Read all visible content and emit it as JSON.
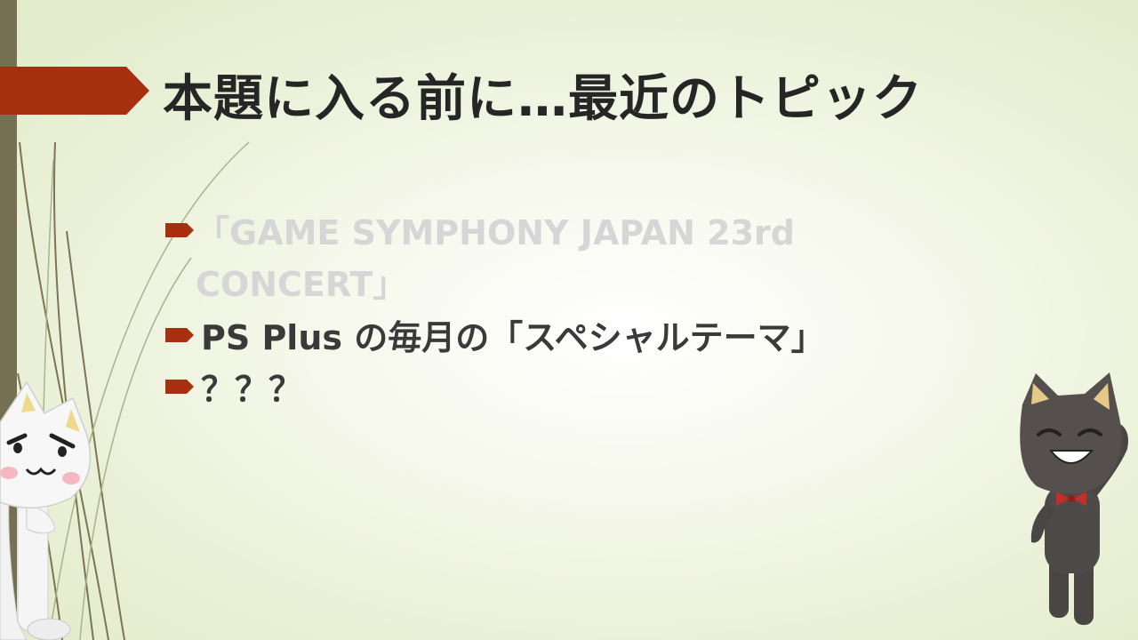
{
  "slide": {
    "title": "本題に入る前に…最近のトピック",
    "bullets": [
      {
        "text": "「GAME SYMPHONY JAPAN 23rd CONCERT」",
        "state": "faded"
      },
      {
        "text": "PS Plus の毎月の「スペシャルテーマ」",
        "state": "active"
      },
      {
        "text": "？？？",
        "state": "active"
      }
    ]
  },
  "colors": {
    "accent": "#A6300F",
    "title_text": "#262626",
    "body_text": "#3A3A3A",
    "faded_text": "#D6D6D6",
    "left_bar": "#767052",
    "background": "#E9F0D6"
  },
  "decorations": {
    "left_character": "white-cat-mascot",
    "right_character": "black-cat-mascot-with-red-bowtie"
  }
}
